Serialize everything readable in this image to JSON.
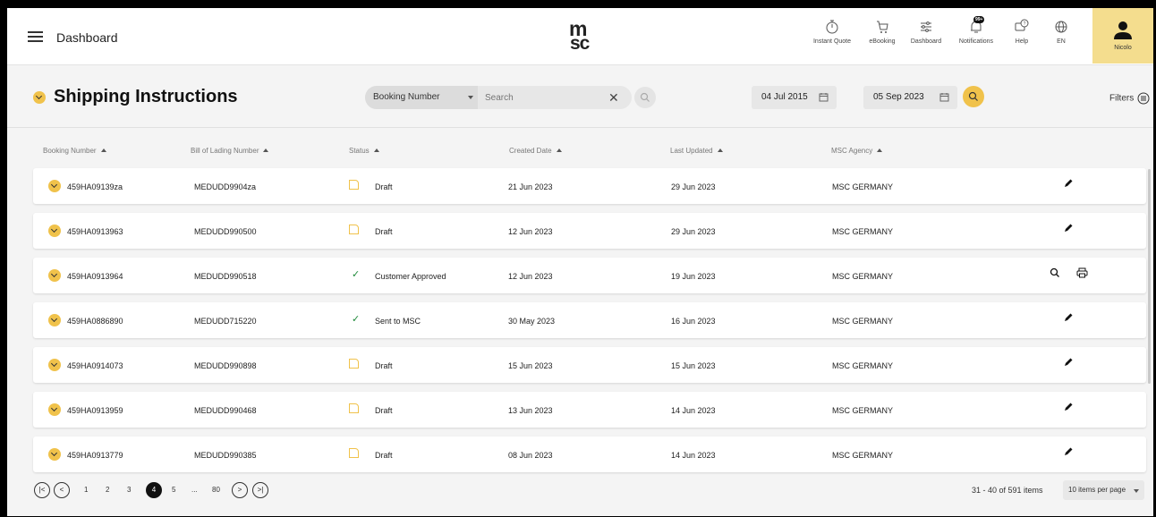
{
  "header": {
    "title": "Dashboard",
    "logo_top": "m",
    "logo_bottom": "sc",
    "nav": [
      {
        "label": "Instant Quote",
        "icon": "stopwatch-icon"
      },
      {
        "label": "eBooking",
        "icon": "cart-icon"
      },
      {
        "label": "Dashboard",
        "icon": "sliders-icon"
      },
      {
        "label": "Notifications",
        "icon": "bell-icon",
        "badge": "99+"
      },
      {
        "label": "Help",
        "icon": "help-chat-icon"
      },
      {
        "label": "EN",
        "icon": "globe-icon"
      }
    ],
    "user": "Nicolo"
  },
  "toolbar": {
    "title": "Shipping Instructions",
    "search_type": "Booking Number",
    "search_placeholder": "Search",
    "date_from": "04 Jul 2015",
    "date_to": "05 Sep 2023",
    "filters_label": "Filters"
  },
  "table": {
    "columns": [
      "Booking Number",
      "Bill of Lading Number",
      "Status",
      "Created Date",
      "Last Updated",
      "MSC Agency"
    ],
    "rows": [
      {
        "booking": "459HA09139za",
        "bol": "MEDUDD9904za",
        "status": "Draft",
        "created": "21 Jun 2023",
        "updated": "29 Jun 2023",
        "agency": "MSC GERMANY",
        "actions": [
          "edit"
        ]
      },
      {
        "booking": "459HA0913963",
        "bol": "MEDUDD990500",
        "status": "Draft",
        "created": "12 Jun 2023",
        "updated": "29 Jun 2023",
        "agency": "MSC GERMANY",
        "actions": [
          "edit"
        ]
      },
      {
        "booking": "459HA0913964",
        "bol": "MEDUDD990518",
        "status": "Customer Approved",
        "created": "12 Jun 2023",
        "updated": "19 Jun 2023",
        "agency": "MSC GERMANY",
        "actions": [
          "view",
          "print"
        ]
      },
      {
        "booking": "459HA0886890",
        "bol": "MEDUDD715220",
        "status": "Sent to MSC",
        "created": "30 May 2023",
        "updated": "16 Jun 2023",
        "agency": "MSC GERMANY",
        "actions": [
          "edit"
        ]
      },
      {
        "booking": "459HA0914073",
        "bol": "MEDUDD990898",
        "status": "Draft",
        "created": "15 Jun 2023",
        "updated": "15 Jun 2023",
        "agency": "MSC GERMANY",
        "actions": [
          "edit"
        ]
      },
      {
        "booking": "459HA0913959",
        "bol": "MEDUDD990468",
        "status": "Draft",
        "created": "13 Jun 2023",
        "updated": "14 Jun 2023",
        "agency": "MSC GERMANY",
        "actions": [
          "edit"
        ]
      },
      {
        "booking": "459HA0913779",
        "bol": "MEDUDD990385",
        "status": "Draft",
        "created": "08 Jun 2023",
        "updated": "14 Jun 2023",
        "agency": "MSC GERMANY",
        "actions": [
          "edit"
        ]
      }
    ]
  },
  "pagination": {
    "pages": [
      "1",
      "2",
      "3",
      "4",
      "5",
      "...",
      "80"
    ],
    "current": "4",
    "first": "|<",
    "prev": "<",
    "next": ">",
    "last": ">|",
    "items_summary": "31 - 40 of 591 items",
    "per_page": "10 items per page"
  },
  "colors": {
    "accent": "#f0c24b",
    "user_tile": "#f4dd8e",
    "approved_check": "#1f8a3a"
  }
}
